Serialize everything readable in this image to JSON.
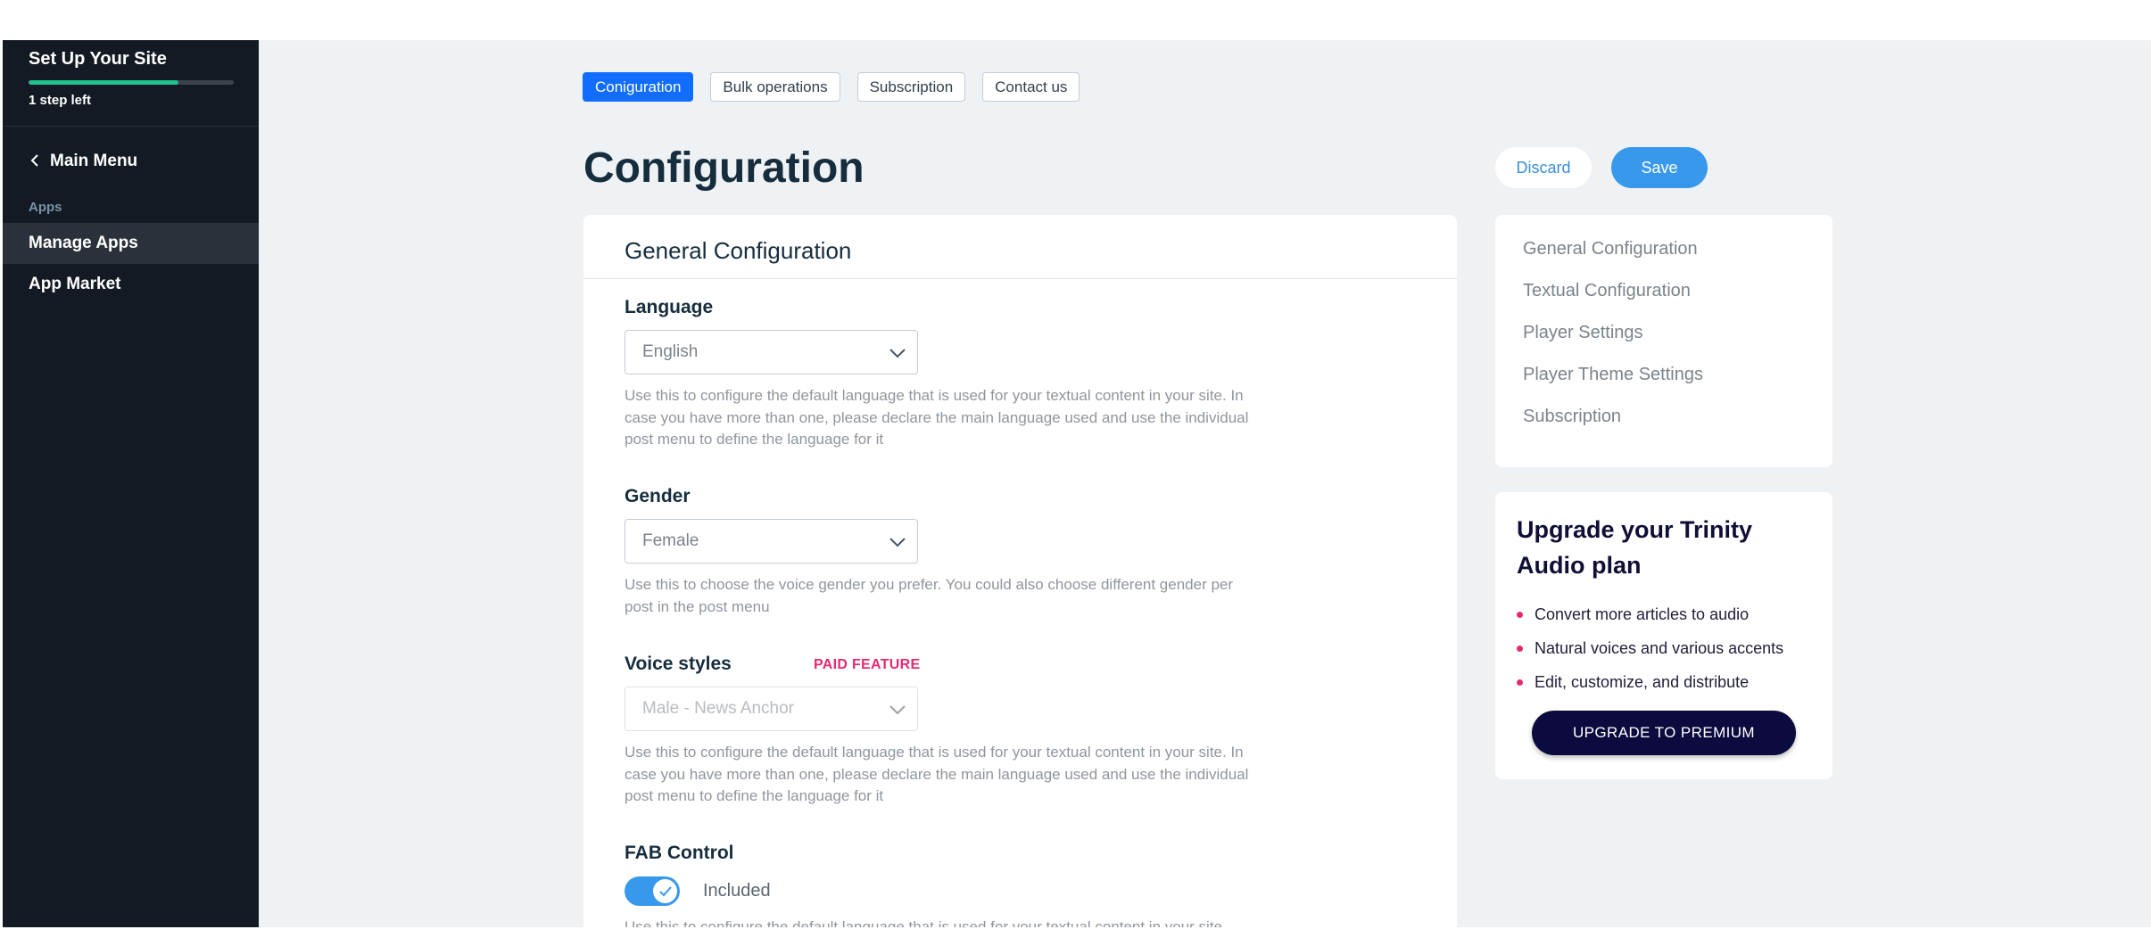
{
  "sidebar": {
    "setup_title": "Set Up Your Site",
    "steps_left": "1 step left",
    "progress": 0.73,
    "main_menu": "Main Menu",
    "section_label": "Apps",
    "items": [
      {
        "label": "Manage Apps",
        "active": true
      },
      {
        "label": "App Market",
        "active": false
      }
    ]
  },
  "tabs": [
    {
      "label": "Coniguration",
      "active": true
    },
    {
      "label": "Bulk operations",
      "active": false
    },
    {
      "label": "Subscription",
      "active": false
    },
    {
      "label": "Contact us",
      "active": false
    }
  ],
  "page": {
    "title": "Configuration",
    "discard_label": "Discard",
    "save_label": "Save"
  },
  "general": {
    "header": "General Configuration",
    "language": {
      "label": "Language",
      "value": "English",
      "help": "Use this to configure the default language that is used for your textual content in your site. In case you have more than one, please declare the main language used and use the individual post menu to define the language for it"
    },
    "gender": {
      "label": "Gender",
      "value": "Female",
      "help": "Use this to choose the voice gender you prefer. You could also choose different gender per post in the post menu"
    },
    "voice_styles": {
      "label": "Voice styles",
      "badge": "PAID FEATURE",
      "value": "Male - News Anchor",
      "help": "Use this to configure the default language that is used for your textual content in your site. In case you have more than one, please declare the main language used and use the individual post menu to define the language for it"
    },
    "fab": {
      "label": "FAB Control",
      "toggle_label": "Included",
      "enabled": true,
      "help": "Use this to configure the default language that is used for your textual content in your site."
    }
  },
  "side_nav": [
    "General Configuration",
    "Textual Configuration",
    "Player Settings",
    "Player Theme Settings",
    "Subscription"
  ],
  "promo": {
    "title": "Upgrade your Trinity Audio plan",
    "bullets": [
      "Convert more articles to audio",
      "Natural voices and various accents",
      "Edit, customize, and distribute"
    ],
    "cta": "UPGRADE TO PREMIUM"
  },
  "colors": {
    "accent": "#116dff",
    "save": "#3899ec",
    "paid": "#e62a72",
    "sidebar_bg": "#131a23",
    "progress": "#21c28c"
  }
}
